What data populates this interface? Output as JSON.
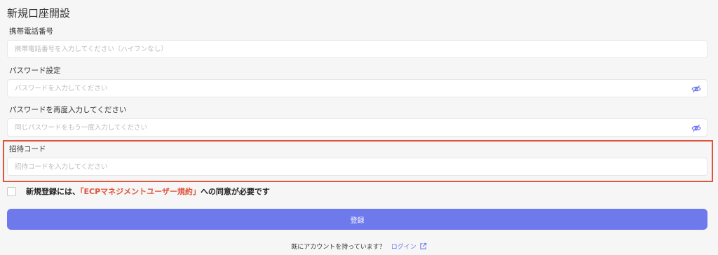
{
  "page": {
    "title": "新規口座開設"
  },
  "form": {
    "phone": {
      "label": "携帯電話番号",
      "placeholder": "携帯電話番号を入力してください（ハイフンなし）"
    },
    "password": {
      "label": "パスワード設定",
      "placeholder": "パスワードを入力してください",
      "toggle_icon": "eye-slash-icon"
    },
    "password_confirm": {
      "label": "パスワードを再度入力してください",
      "placeholder": "同じパスワードをもう一度入力してください",
      "toggle_icon": "eye-slash-icon"
    },
    "invite": {
      "label": "招待コード",
      "placeholder": "招待コードを入力してください"
    }
  },
  "agreement": {
    "prefix": "新規登録には、",
    "terms": "「ECPマネジメントユーザー規約」",
    "suffix": "への同意が必要です"
  },
  "register_button": "登録",
  "footer": {
    "text": "既にアカウントを持っています？",
    "login_link": "ログイン",
    "link_icon": "external-link-icon"
  },
  "colors": {
    "accent": "#6e79ec",
    "highlight": "#e0533c",
    "terms_link": "#e0533c"
  }
}
